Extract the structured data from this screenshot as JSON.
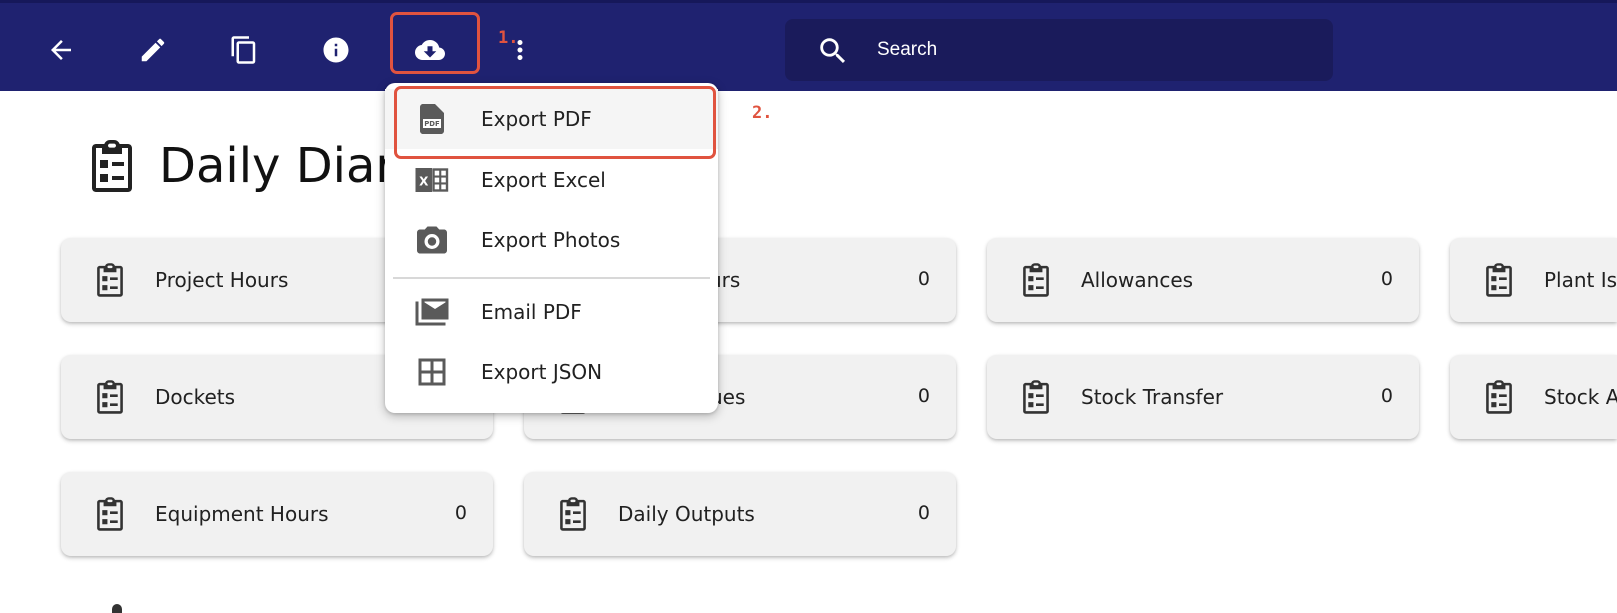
{
  "toolbar": {
    "icons": [
      "back-arrow-icon",
      "edit-pencil-icon",
      "copy-icon",
      "info-icon",
      "cloud-download-icon",
      "more-vert-icon"
    ],
    "search_placeholder": "Search"
  },
  "annotations": {
    "step1": "1.",
    "step2": "2."
  },
  "page": {
    "title": "Daily Diar"
  },
  "export_menu": {
    "items": [
      {
        "label": "Export PDF",
        "icon": "pdf-file-icon"
      },
      {
        "label": "Export Excel",
        "icon": "excel-icon"
      },
      {
        "label": "Export Photos",
        "icon": "camera-icon"
      },
      {
        "label": "Email PDF",
        "icon": "email-icon"
      },
      {
        "label": "Export JSON",
        "icon": "grid-icon"
      }
    ]
  },
  "cards": [
    {
      "label": "Project Hours",
      "count": ""
    },
    {
      "label": "urs",
      "count": "0"
    },
    {
      "label": "Allowances",
      "count": "0"
    },
    {
      "label": "Plant Is",
      "count": ""
    },
    {
      "label": "Dockets",
      "count": ""
    },
    {
      "label": "ues",
      "count": "0"
    },
    {
      "label": "Stock Transfer",
      "count": "0"
    },
    {
      "label": "Stock A",
      "count": ""
    },
    {
      "label": "Equipment Hours",
      "count": "0"
    },
    {
      "label": "Daily Outputs",
      "count": "0"
    }
  ],
  "colors": {
    "topbar": "#1f2270",
    "search_bg": "#1a1b5b",
    "highlight": "#e0533f",
    "card_bg": "#f1f1f1"
  }
}
